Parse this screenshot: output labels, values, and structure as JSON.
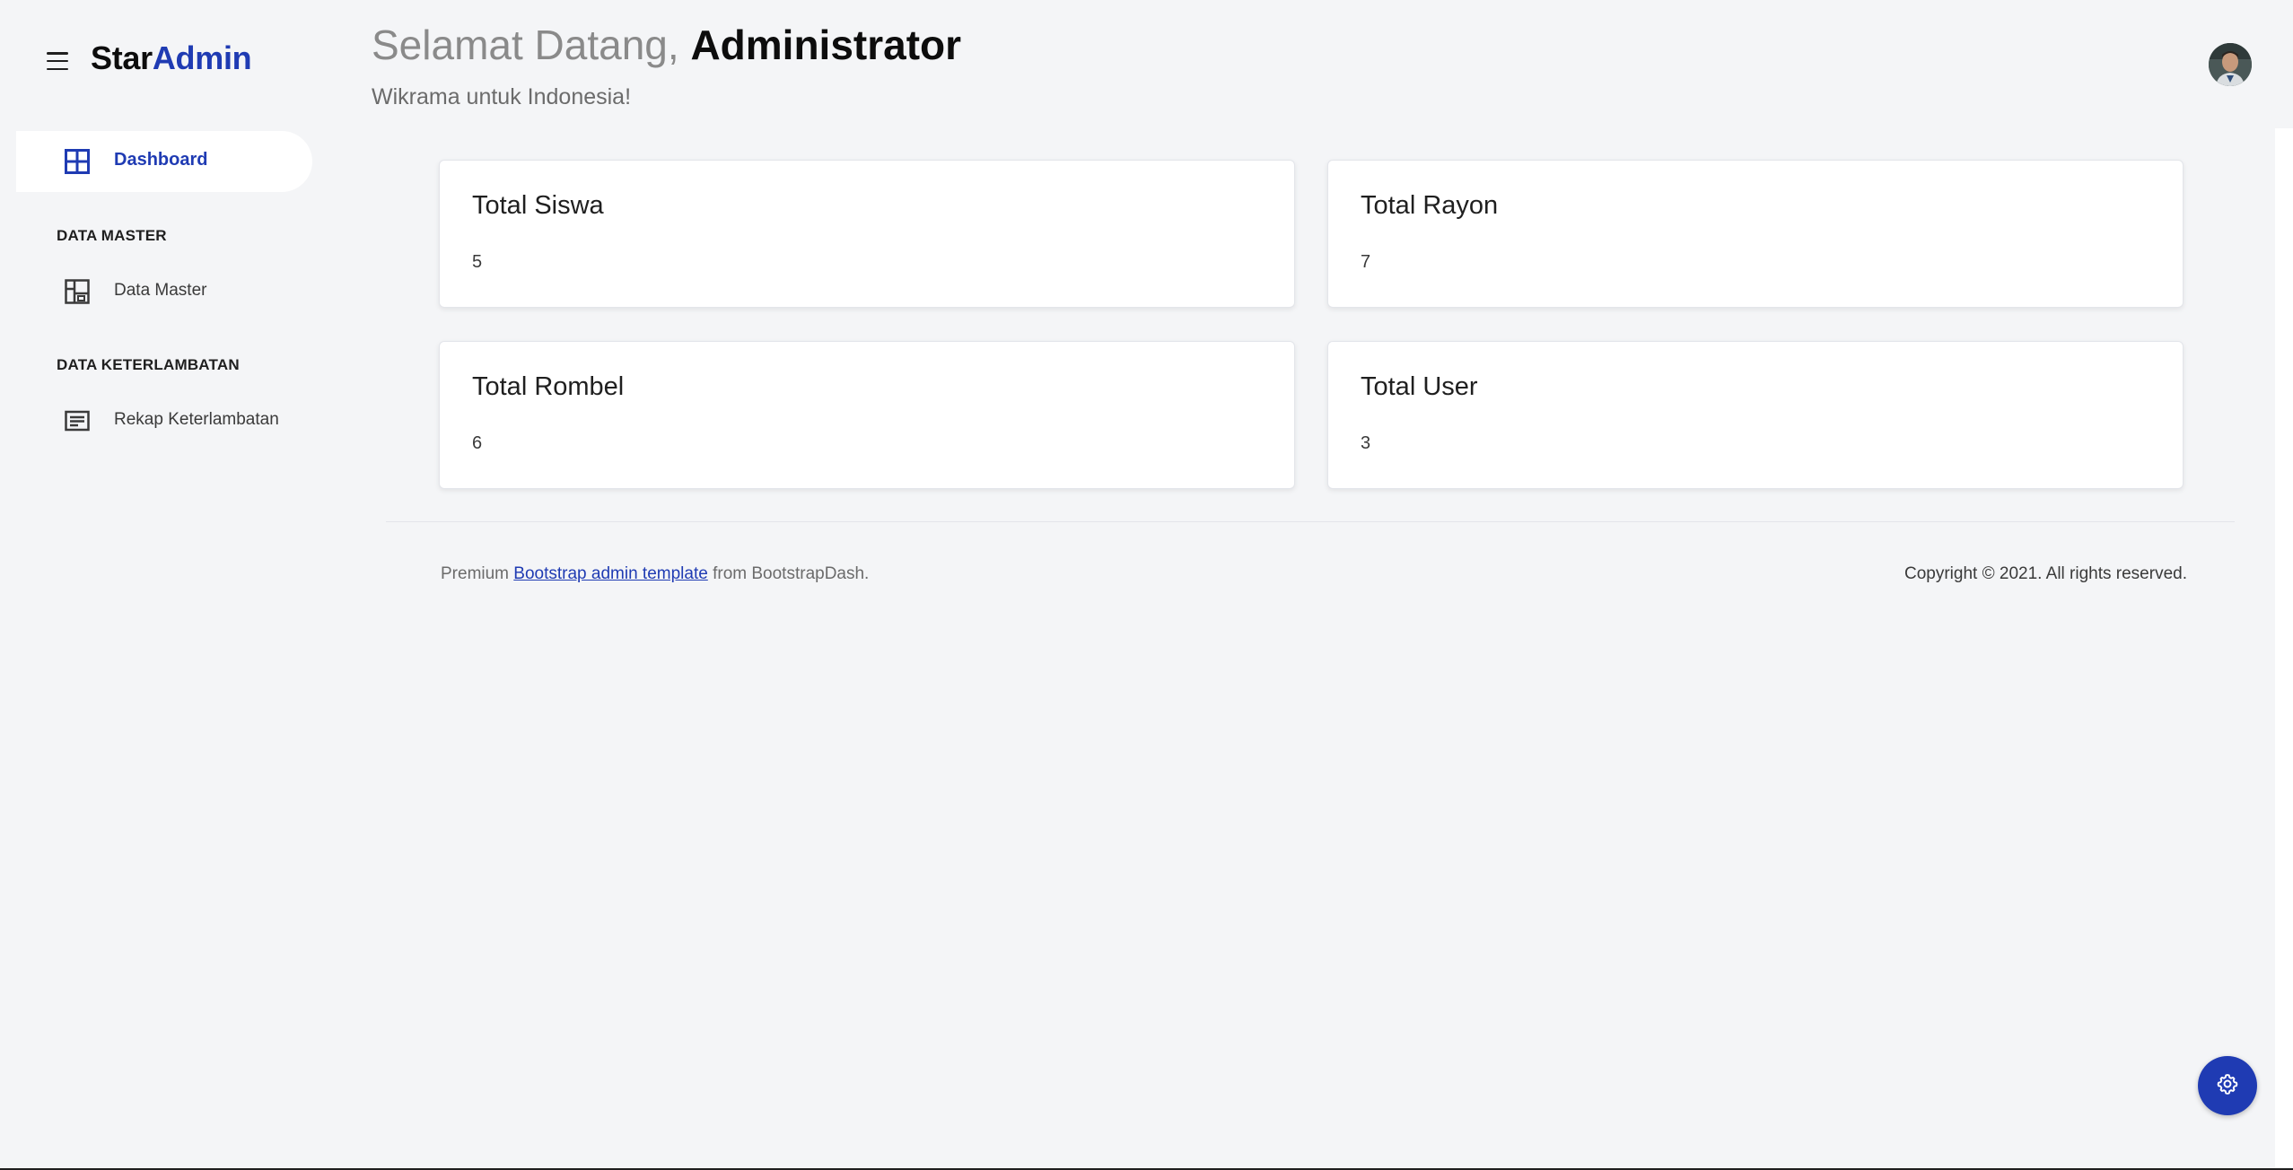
{
  "brand": {
    "part1": "Star",
    "part2": "Admin"
  },
  "header": {
    "greeting": "Selamat Datang,",
    "user_name": "Administrator",
    "subtitle": "Wikrama untuk Indonesia!"
  },
  "sidebar": {
    "active_item": {
      "label": "Dashboard",
      "icon": "grid-icon"
    },
    "sections": [
      {
        "title": "DATA MASTER",
        "items": [
          {
            "label": "Data Master",
            "icon": "layout-icon"
          }
        ]
      },
      {
        "title": "DATA KETERLAMBATAN",
        "items": [
          {
            "label": "Rekap Keterlambatan",
            "icon": "list-icon"
          }
        ]
      }
    ]
  },
  "cards": [
    {
      "title": "Total Siswa",
      "value": "5"
    },
    {
      "title": "Total Rayon",
      "value": "7"
    },
    {
      "title": "Total Rombel",
      "value": "6"
    },
    {
      "title": "Total User",
      "value": "3"
    }
  ],
  "footer": {
    "prefix": "Premium",
    "link_text": "Bootstrap admin template",
    "suffix": "from BootstrapDash.",
    "copyright": "Copyright © 2021. All rights reserved."
  },
  "colors": {
    "accent": "#1f3bb3",
    "background": "#f4f5f7",
    "card": "#ffffff"
  },
  "icons": {
    "menu": "hamburger-icon",
    "settings": "gear-icon",
    "avatar": "user-avatar"
  }
}
